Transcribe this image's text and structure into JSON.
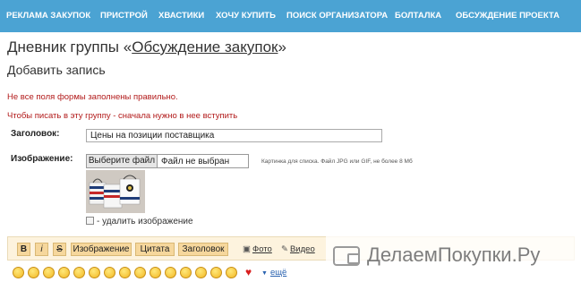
{
  "nav": {
    "items": [
      "РЕКЛАМА ЗАКУПОК",
      "ПРИСТРОЙ",
      "ХВАСТИКИ",
      "ХОЧУ КУПИТЬ",
      "ПОИСК ОРГАНИЗАТОРА",
      "БОЛТАЛКА",
      "ОБСУЖДЕНИЕ ПРОЕКТА"
    ]
  },
  "colors": {
    "nav_bg": "#4ba3d3",
    "error": "#b21a1a",
    "toolbar_bg": "#fdf3de",
    "toolbar_button": "#f6d79c",
    "link": "#2a63b0"
  },
  "page": {
    "title_prefix": "Дневник группы «",
    "title_link": "Обсуждение закупок",
    "title_suffix": "»",
    "subtitle": "Добавить запись"
  },
  "errors": {
    "line1": "Не все поля формы заполнены правильно.",
    "line2": "Чтобы писать в эту группу - сначала нужно в нее вступить"
  },
  "form": {
    "title_label": "Заголовок:",
    "title_value": "Цены на позиции поставщика",
    "image_label": "Изображение:",
    "file_button": "Выберите файл",
    "file_status": "Файл не выбран",
    "file_hint": "Картинка для списка. Файл JPG или GIF, не более 8 Мб",
    "thumbnail_icon": "bags-photo-icon",
    "delete_image": "- удалить изображение"
  },
  "toolbar": {
    "bold": "B",
    "italic": "i",
    "strike": "S",
    "image": "Изображение",
    "quote": "Цитата",
    "heading": "Заголовок",
    "photo": "Фото",
    "video": "Видео"
  },
  "watermark": {
    "text": "ДелаемПокупки.Ру",
    "icon": "wallet-icon"
  },
  "smileys": {
    "icons": [
      "smile-icon",
      "sad-icon",
      "wink-icon",
      "grin-icon",
      "laugh-icon",
      "tongue-icon",
      "cool-icon",
      "hug-icon",
      "angry-icon",
      "girl-icon",
      "kiss-icon",
      "cry-icon",
      "love-icon",
      "wave-icon",
      "confused-icon",
      "surprised-icon",
      "blush-icon",
      "heart-icon"
    ],
    "more": "ещё"
  }
}
